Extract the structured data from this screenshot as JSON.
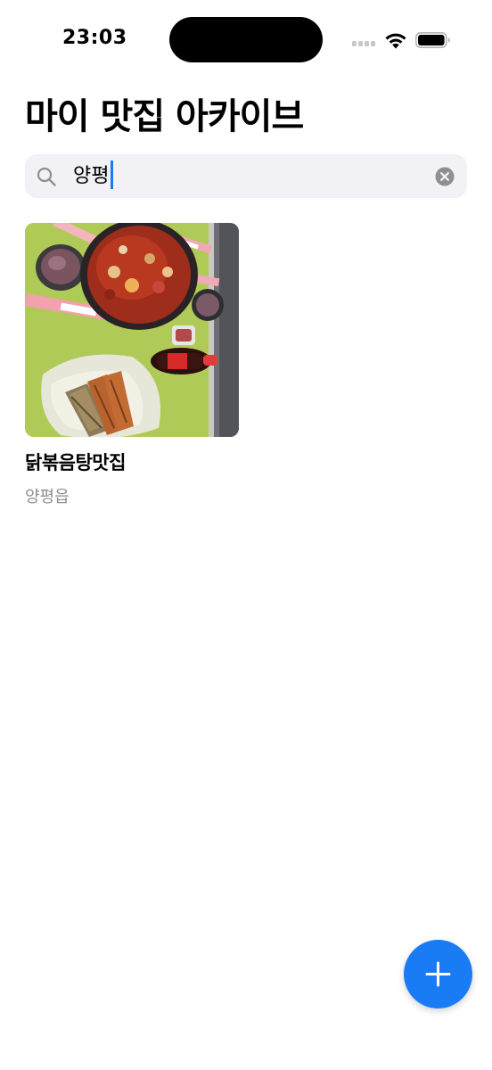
{
  "status_bar": {
    "time": "23:03"
  },
  "header": {
    "title": "마이 맛집 아카이브"
  },
  "search": {
    "value": "양평",
    "icon": "search-icon",
    "clear_icon": "clear-icon"
  },
  "results": [
    {
      "name": "닭볶음탕맛집",
      "location": "양평읍",
      "photo": "food-photo"
    }
  ],
  "fab": {
    "icon": "plus-icon",
    "color": "#1a7cf5"
  },
  "colors": {
    "accent": "#1a7cf5",
    "search_background": "#f2f2f6",
    "secondary_text": "#8e8e93"
  }
}
